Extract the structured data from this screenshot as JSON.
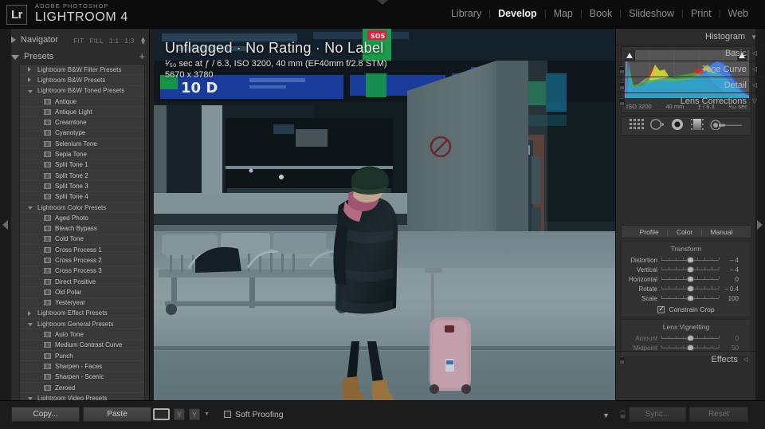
{
  "app": {
    "logo_text": "Lr",
    "brand_superscript": "ADOBE PHOTOSHOP",
    "brand_title": "LIGHTROOM 4"
  },
  "modules": [
    {
      "label": "Library",
      "active": false
    },
    {
      "label": "Develop",
      "active": true
    },
    {
      "label": "Map",
      "active": false
    },
    {
      "label": "Book",
      "active": false
    },
    {
      "label": "Slideshow",
      "active": false
    },
    {
      "label": "Print",
      "active": false
    },
    {
      "label": "Web",
      "active": false
    }
  ],
  "left_panel": {
    "navigator": {
      "label": "Navigator",
      "zoom_options": [
        "FIT",
        "FILL",
        "1:1",
        "1:3"
      ]
    },
    "presets": {
      "label": "Presets",
      "add_label": "+",
      "items": [
        {
          "label": "Lightroom B&W Filter Presets",
          "type": "group",
          "expanded": false
        },
        {
          "label": "Lightroom B&W Presets",
          "type": "group",
          "expanded": false
        },
        {
          "label": "Lightroom B&W Toned Presets",
          "type": "group",
          "expanded": true
        },
        {
          "label": "Antique",
          "type": "leaf"
        },
        {
          "label": "Antique Light",
          "type": "leaf"
        },
        {
          "label": "Creamtone",
          "type": "leaf"
        },
        {
          "label": "Cyanotype",
          "type": "leaf"
        },
        {
          "label": "Selenium Tone",
          "type": "leaf"
        },
        {
          "label": "Sepia Tone",
          "type": "leaf"
        },
        {
          "label": "Split Tone 1",
          "type": "leaf"
        },
        {
          "label": "Split Tone 2",
          "type": "leaf"
        },
        {
          "label": "Split Tone 3",
          "type": "leaf"
        },
        {
          "label": "Split Tone 4",
          "type": "leaf"
        },
        {
          "label": "Lightroom Color Presets",
          "type": "group",
          "expanded": true
        },
        {
          "label": "Aged Photo",
          "type": "leaf"
        },
        {
          "label": "Bleach Bypass",
          "type": "leaf"
        },
        {
          "label": "Cold Tone",
          "type": "leaf"
        },
        {
          "label": "Cross Process 1",
          "type": "leaf"
        },
        {
          "label": "Cross Process 2",
          "type": "leaf"
        },
        {
          "label": "Cross Process 3",
          "type": "leaf"
        },
        {
          "label": "Direct Positive",
          "type": "leaf"
        },
        {
          "label": "Old Polar",
          "type": "leaf"
        },
        {
          "label": "Yesteryear",
          "type": "leaf"
        },
        {
          "label": "Lightroom Effect Presets",
          "type": "group",
          "expanded": false
        },
        {
          "label": "Lightroom General Presets",
          "type": "group",
          "expanded": true
        },
        {
          "label": "Auto Tone",
          "type": "leaf"
        },
        {
          "label": "Medium Contrast Curve",
          "type": "leaf"
        },
        {
          "label": "Punch",
          "type": "leaf"
        },
        {
          "label": "Sharpen - Faces",
          "type": "leaf"
        },
        {
          "label": "Sharpen - Scenic",
          "type": "leaf"
        },
        {
          "label": "Zeroed",
          "type": "leaf"
        },
        {
          "label": "Lightroom Video Presets",
          "type": "group",
          "expanded": true
        }
      ]
    }
  },
  "image_overlay": {
    "flag_status": "Unflagged",
    "rating": "No Rating",
    "label_status": "No Label",
    "separator": "·",
    "exif": "¹⁄₅₀ sec at ƒ / 6.3, ISO 3200, 40 mm (EF40mm f/2.8 STM)",
    "dimensions": "5670 x 3780"
  },
  "right_panel": {
    "histogram": {
      "title": "Histogram",
      "iso": "ISO 3200",
      "focal_length": "40 mm",
      "aperture": "ƒ / 6.3",
      "shutter": "¹⁄₅₀ sec"
    },
    "tools": [
      "crop-overlay-tool",
      "spot-removal-tool",
      "red-eye-correction-tool",
      "graduated-filter-tool",
      "adjustment-brush-tool"
    ],
    "sections": [
      {
        "label": "Basic",
        "expanded": false
      },
      {
        "label": "Tone Curve",
        "expanded": false
      },
      {
        "label": "Detail",
        "expanded": false
      },
      {
        "label": "Lens Corrections",
        "expanded": true
      },
      {
        "label": "Effects",
        "expanded": false
      }
    ],
    "lens_corrections": {
      "tabs": [
        "Profile",
        "Color",
        "Manual"
      ],
      "active_tab": "Manual",
      "transform": {
        "title": "Transform",
        "sliders": [
          {
            "label": "Distortion",
            "value": "– 4",
            "pos": 50,
            "dim": false
          },
          {
            "label": "Vertical",
            "value": "– 4",
            "pos": 50,
            "dim": false
          },
          {
            "label": "Horizontal",
            "value": "0",
            "pos": 50,
            "dim": false
          },
          {
            "label": "Rotate",
            "value": "– 0.4",
            "pos": 50,
            "dim": false
          },
          {
            "label": "Scale",
            "value": "100",
            "pos": 50,
            "dim": false
          }
        ],
        "constrain_crop_label": "Constrain Crop",
        "constrain_crop_checked": true
      },
      "vignetting": {
        "title": "Lens Vignetting",
        "sliders": [
          {
            "label": "Amount",
            "value": "0",
            "pos": 50,
            "dim": true
          },
          {
            "label": "Midpoint",
            "value": "50",
            "pos": 50,
            "dim": true
          }
        ]
      }
    }
  },
  "bottom_bar": {
    "copy_label": "Copy...",
    "paste_label": "Paste",
    "soft_proofing_label": "Soft Proofing",
    "soft_proofing_checked": false,
    "sync_label": "Sync...",
    "reset_label": "Reset"
  },
  "colors": {
    "panel_bg": "#2c2c2c",
    "accent_text": "#f2f2f2",
    "muted_text": "#8e8e8e"
  }
}
